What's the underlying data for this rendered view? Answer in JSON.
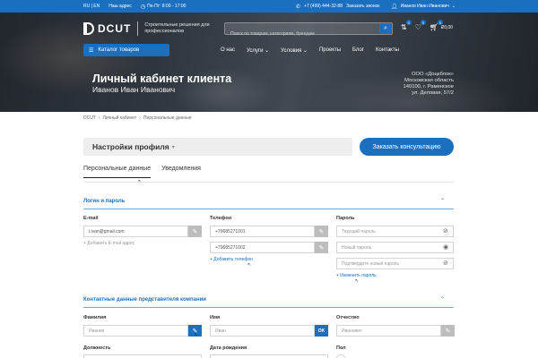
{
  "topbar": {
    "lang": "RU | EN",
    "stores": "Наш адрес",
    "hours": "Пн-Пт: 8:00 - 17:00",
    "phone": "+7 (499) 444-32-88",
    "callback": "Заказать звонок",
    "user": "Иванов Иван Иванович"
  },
  "header": {
    "logo": "DCUT",
    "tagline": "Строительные решения для профессионалов",
    "search_placeholder": "Поиск по товарам, категориям, брендам",
    "cart_sum": "₽0,00",
    "badge_compare": "0",
    "badge_fav": "0",
    "badge_cart": "0"
  },
  "nav": {
    "catalog": "Каталог товаров",
    "items": [
      "О нас",
      "Услуги",
      "Условия",
      "Проекты",
      "Блог",
      "Контакты"
    ]
  },
  "hero": {
    "title": "Личный кабинет клиента",
    "subtitle": "Иванов Иван Иванович",
    "address_line1": "ООО «Доцкблок»",
    "address_line2": "Московская область",
    "address_line3": "140100, г. Раменское",
    "address_line4": "ул. Деповая, 57/2"
  },
  "breadcrumb": {
    "home": "DCUT",
    "cabinet": "Личный кабинет",
    "current": "Персональные данные"
  },
  "profile": {
    "settings": "Настройки профиля",
    "consult": "Заказать консультацию",
    "tab_personal": "Персональные данные",
    "tab_notifications": "Уведомления"
  },
  "login_section": {
    "title": "Логин и пароль",
    "email_label": "E-mail",
    "email_value": "i.ivan@gmail.com",
    "add_email": "+ Добавить E-mail адрес",
    "phone_label": "Телефон",
    "phone_1": "+79685271001",
    "phone_2": "+79685271002",
    "add_phone": "+ Добавить телефон",
    "password_label": "Пароль",
    "current_password": "Текущий пароль",
    "new_password": "Новый пароль",
    "confirm_password": "Подтвердите новый пароль",
    "change_password": "+ Изменить пароль"
  },
  "contact_section": {
    "title": "Контактные данные представителя компании",
    "last_name_label": "Фамилия",
    "last_name_value": "Иванов",
    "first_name_label": "Имя",
    "first_name_value": "Иван",
    "ok": "OK",
    "middle_name_label": "Отчество",
    "middle_name_value": "Иванович",
    "position_label": "Должность",
    "birth_label": "Дата рождения",
    "gender_label": "Пол"
  },
  "colors": {
    "accent": "#1b6fbf"
  }
}
